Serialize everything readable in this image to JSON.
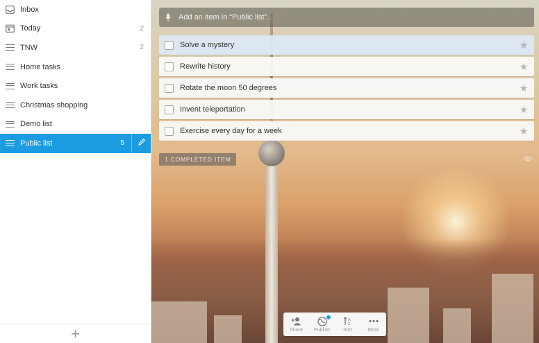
{
  "sidebar": {
    "items": [
      {
        "label": "Inbox",
        "count": "",
        "icon": "inbox-icon"
      },
      {
        "label": "Today",
        "count": "2",
        "icon": "calendar-icon"
      },
      {
        "label": "TNW",
        "count": "2",
        "icon": "list-icon"
      },
      {
        "label": "Home tasks",
        "count": "",
        "icon": "list-icon"
      },
      {
        "label": "Work tasks",
        "count": "",
        "icon": "list-icon"
      },
      {
        "label": "Christmas shopping",
        "count": "",
        "icon": "list-icon"
      },
      {
        "label": "Demo list",
        "count": "",
        "icon": "list-icon"
      },
      {
        "label": "Public list",
        "count": "5",
        "icon": "list-icon",
        "active": true
      }
    ],
    "add_icon": "plus-icon"
  },
  "main": {
    "add_placeholder": "Add an item in “Public list”...",
    "tasks": [
      {
        "title": "Solve a mystery",
        "selected": true
      },
      {
        "title": "Rewrite history"
      },
      {
        "title": "Rotate the moon 50 degrees"
      },
      {
        "title": "Invent teleportation"
      },
      {
        "title": "Exercise every day for a week"
      }
    ],
    "completed_label": "1 COMPLETED ITEM"
  },
  "toolbar": {
    "share": "Share",
    "publish": "Publish",
    "sort": "Sort",
    "more": "More"
  },
  "colors": {
    "accent": "#1b9ce2"
  }
}
